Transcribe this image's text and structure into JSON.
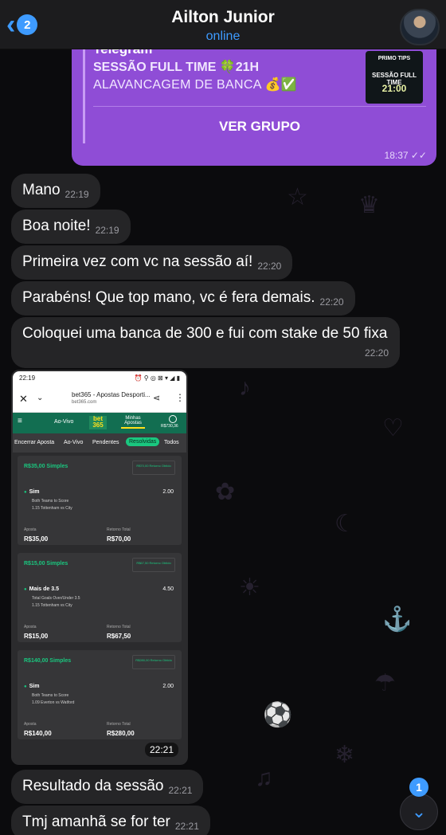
{
  "header": {
    "back_count": "2",
    "contact_name": "Ailton Junior",
    "status": "online"
  },
  "promo": {
    "telegram": "Telegram",
    "line1": "SESSÃO FULL TIME 🍀21H",
    "line2": "ALAVANCAGEM DE BANCA 💰✅",
    "thumb_title": "PRIMO TIPS",
    "thumb_subtitle": "SESSÃO FULL TIME",
    "thumb_time": "21:00",
    "button": "VER GRUPO",
    "time": "18:37 ✓✓"
  },
  "messages": [
    {
      "text": "Mano",
      "time": "22:19"
    },
    {
      "text": "Boa noite!",
      "time": "22:19"
    },
    {
      "text": "Primeira vez com vc na sessão aí!",
      "time": "22:20"
    },
    {
      "text": "Parabéns! Que top mano, vc é fera demais.",
      "time": "22:20"
    },
    {
      "text": "Coloquei uma banca de 300 e fui com stake de 50 fixa",
      "time": "22:20"
    }
  ],
  "screenshot": {
    "statusbar_time": "22:19",
    "statusbar_icons": "⏰ ⚲ ◎ ⊠ ▾ ◢ ▮",
    "url_title": "bet365 - Apostas Desporti...",
    "url_domain": "bet365.com",
    "nav_live": "Ao-Vivo",
    "nav_logo": "bet 365",
    "nav_my_bets": "Minhas Apostas",
    "nav_balance": "R$730,36",
    "filters": [
      "Encerrar Aposta",
      "Ao-Vivo",
      "Pendentes",
      "Resolvidas",
      "Todos"
    ],
    "bets": [
      {
        "header": "R$35,00 Simples",
        "return_badge": "R$70,00 Retorno Obtido",
        "selection": "Sim",
        "odds": "2.00",
        "market": "Both Teams to Score",
        "event": "1.15 Tottenham vs City",
        "stake_label": "Aposta",
        "stake": "R$35,00",
        "return_label": "Retorno Total",
        "return": "R$70,00"
      },
      {
        "header": "R$15,00 Simples",
        "return_badge": "R$67,50 Retorno Obtido",
        "selection": "Mais de 3.5",
        "odds": "4.50",
        "market": "Total Goals Over/Under 3.5",
        "event": "1.15 Tottenham vs City",
        "stake_label": "Aposta",
        "stake": "R$15,00",
        "return_label": "Retorno Total",
        "return": "R$67,50"
      },
      {
        "header": "R$140,00 Simples",
        "return_badge": "R$280,00 Retorno Obtido",
        "selection": "Sim",
        "odds": "2.00",
        "market": "Both Teams to Score",
        "event": "1.09 Everton vs Watford",
        "stake_label": "Aposta",
        "stake": "R$140,00",
        "return_label": "Retorno Total",
        "return": "R$280,00"
      }
    ],
    "time": "22:21"
  },
  "messages_after": [
    {
      "text": "Resultado da sessão",
      "time": "22:21"
    },
    {
      "text": "Tmj amanhã se for ter",
      "time": "22:21"
    }
  ],
  "scroll": {
    "badge": "1"
  },
  "icons": {
    "back": "chevron-left-icon",
    "scroll_down": "chevron-down-icon",
    "read_receipt": "double-check-icon"
  },
  "colors": {
    "accent": "#3e9bff",
    "outgoing_bubble": "#8f4dd6",
    "incoming_bubble": "#252527",
    "bet365_green": "#126e51",
    "bet365_highlight": "#1ac77f"
  }
}
